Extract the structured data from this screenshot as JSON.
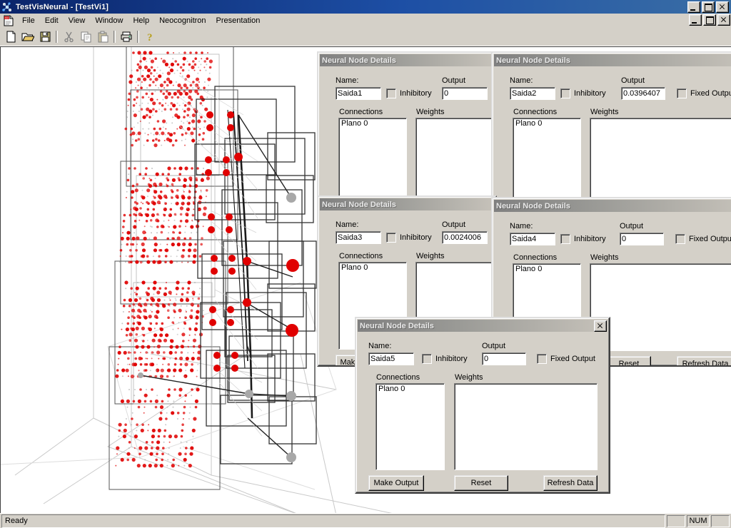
{
  "window": {
    "title": "TestVisNeural - [TestVi1]",
    "app_icon": "neural-app-icon",
    "doc_icon": "document-icon",
    "controls": [
      {
        "name": "minimize",
        "glyph": "_"
      },
      {
        "name": "maximize",
        "glyph": "□"
      },
      {
        "name": "close",
        "glyph": "×"
      }
    ],
    "mdi_controls": [
      {
        "name": "minimize",
        "glyph": "_"
      },
      {
        "name": "restore",
        "glyph": "□"
      },
      {
        "name": "close",
        "glyph": "×"
      }
    ]
  },
  "menu": {
    "items": [
      {
        "label": "File"
      },
      {
        "label": "Edit"
      },
      {
        "label": "View"
      },
      {
        "label": "Window"
      },
      {
        "label": "Help"
      },
      {
        "label": "Neocognitron"
      },
      {
        "label": "Presentation"
      }
    ]
  },
  "toolbar": {
    "buttons": [
      {
        "icon": "new-document-icon",
        "label": "New"
      },
      {
        "icon": "open-folder-icon",
        "label": "Open"
      },
      {
        "icon": "save-floppy-icon",
        "label": "Save"
      },
      {
        "icon": "cut-scissors-icon",
        "label": "Cut"
      },
      {
        "icon": "copy-icon",
        "label": "Copy"
      },
      {
        "icon": "paste-icon",
        "label": "Paste"
      },
      {
        "icon": "print-icon",
        "label": "Print"
      },
      {
        "icon": "help-question-icon",
        "label": "Help"
      }
    ]
  },
  "statusbar": {
    "message": "Ready",
    "panes": [
      "",
      "NUM",
      ""
    ]
  },
  "labels": {
    "name": "Name:",
    "output": "Output",
    "inhibitory": "Inhibitory",
    "fixed_output": "Fixed Output",
    "connections": "Connections",
    "weights": "Weights",
    "make_output": "Make Output",
    "reset": "Reset",
    "refresh_data": "Refresh Data"
  },
  "dialogs": [
    {
      "title": "Neural Node Details",
      "name": "Saida1",
      "output": "0",
      "inhibitory": false,
      "fixed_output": false,
      "connections": [
        "Plano 0"
      ],
      "weights": []
    },
    {
      "title": "Neural Node Details",
      "name": "Saida2",
      "output": "0.0396407",
      "inhibitory": false,
      "fixed_output": false,
      "connections": [
        "Plano 0"
      ],
      "weights": []
    },
    {
      "title": "Neural Node Details",
      "name": "Saida3",
      "output": "0.0024006",
      "inhibitory": false,
      "fixed_output": false,
      "connections": [
        "Plano 0"
      ],
      "weights": []
    },
    {
      "title": "Neural Node Details",
      "name": "Saida4",
      "output": "0",
      "inhibitory": false,
      "fixed_output": false,
      "connections": [
        "Plano 0"
      ],
      "weights": []
    },
    {
      "title": "Neural Node Details",
      "name": "Saida5",
      "output": "0",
      "inhibitory": false,
      "fixed_output": false,
      "connections": [
        "Plano 0"
      ],
      "weights": []
    }
  ],
  "colors": {
    "titlebar_active": "#0a246a",
    "titlebar_inactive": "#808080",
    "face": "#d4d0c8",
    "node_active": "#e00000",
    "node_inactive": "#a8a8a8",
    "canvas": "#ffffff"
  },
  "visualization": {
    "label": "3D neural network plane visualization",
    "node_color_active": "#e00000",
    "node_color_inactive": "#a8a8a8"
  }
}
